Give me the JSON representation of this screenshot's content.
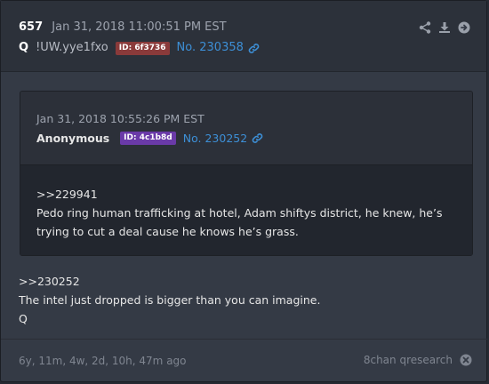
{
  "post": {
    "number": "657",
    "timestamp": "Jan 31, 2018 11:00:51 PM EST",
    "author": "Q",
    "tripcode": "!UW.yye1fxo",
    "id_label": "ID: 6f3736",
    "id_color": "#8a3a3a",
    "link": "No. 230358"
  },
  "quoted": {
    "timestamp": "Jan 31, 2018 10:55:26 PM EST",
    "author": "Anonymous",
    "id_label": "ID: 4c1b8d",
    "id_color": "#6a3aa8",
    "link": "No. 230252",
    "ref": ">>229941",
    "text": "Pedo ring human trafficking at hotel, Adam shiftys district, he knew, he’s trying to cut a deal cause he knows he’s grass."
  },
  "body": {
    "ref": ">>230252",
    "line1": "The intel just dropped is bigger than you can imagine.",
    "line2": "Q"
  },
  "footer": {
    "age": "6y, 11m, 4w, 2d, 10h, 47m ago",
    "source": "8chan qresearch"
  },
  "icons": {
    "share": "share-icon",
    "download": "download-icon",
    "goto": "arrow-right-circle-icon",
    "link": "link-icon",
    "close": "close-circle-icon"
  }
}
